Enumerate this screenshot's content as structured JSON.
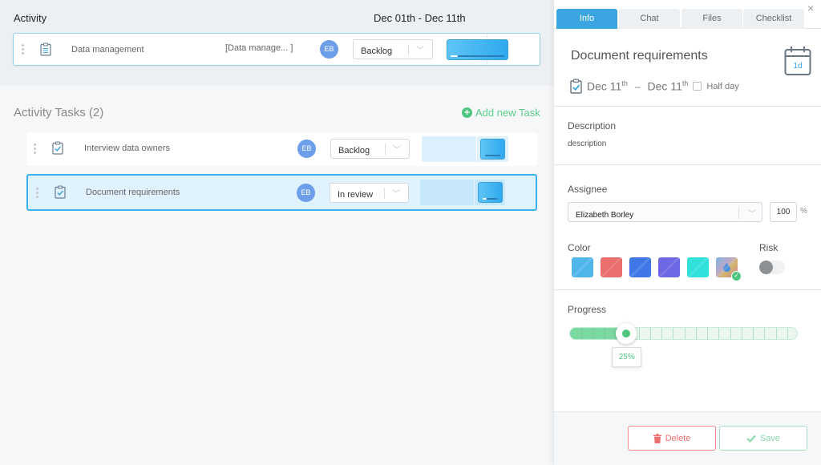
{
  "activity": {
    "title": "Activity",
    "date_range": "Dec 01th -  Dec 11th",
    "row": {
      "name": "Data management",
      "tag": "[Data manage...  ]",
      "assignee_initials": "EB",
      "status": "Backlog",
      "progress_fraction": 0.05
    }
  },
  "tasks": {
    "title": "Activity Tasks (2)",
    "add_label": "Add new Task",
    "items": [
      {
        "name": "Interview data owners",
        "assignee_initials": "EB",
        "status": "Backlog",
        "progress_fraction": 0.0,
        "selected": false
      },
      {
        "name": "Document requirements",
        "assignee_initials": "EB",
        "status": "In review",
        "progress_fraction": 0.25,
        "selected": true
      }
    ]
  },
  "panel": {
    "tabs": [
      {
        "label": "Info",
        "active": true
      },
      {
        "label": "Chat",
        "active": false
      },
      {
        "label": "Files",
        "active": false
      },
      {
        "label": "Checklist",
        "active": false
      }
    ],
    "close_glyph": "×",
    "task_title": "Document requirements",
    "duration_badge": "1d",
    "start_date": "Dec 11",
    "start_suffix": "th",
    "date_sep": "–",
    "end_date": "Dec 11",
    "end_suffix": "th",
    "half_day_label": "Half day",
    "half_day_checked": false,
    "description_label": "Description",
    "description_value": "description",
    "assignee_label": "Assignee",
    "assignee_value": "Elizabeth Borley",
    "allocation_value": "100",
    "allocation_unit": "%",
    "color_label": "Color",
    "risk_label": "Risk",
    "risk_enabled": false,
    "colors": [
      {
        "name": "sky-blue",
        "hex": "#4fb6ea",
        "selected": false
      },
      {
        "name": "red",
        "hex": "#ea6e6e",
        "selected": false
      },
      {
        "name": "blue",
        "hex": "#3f78e6",
        "selected": false
      },
      {
        "name": "purple",
        "hex": "#6d68e3",
        "selected": false
      },
      {
        "name": "cyan",
        "hex": "#2fe0db",
        "selected": false
      },
      {
        "name": "custom",
        "hex": "#c89a8a",
        "selected": true
      }
    ],
    "progress_label": "Progress",
    "progress_percent": 25,
    "progress_text": "25%",
    "delete_label": "Delete",
    "save_label": "Save"
  }
}
